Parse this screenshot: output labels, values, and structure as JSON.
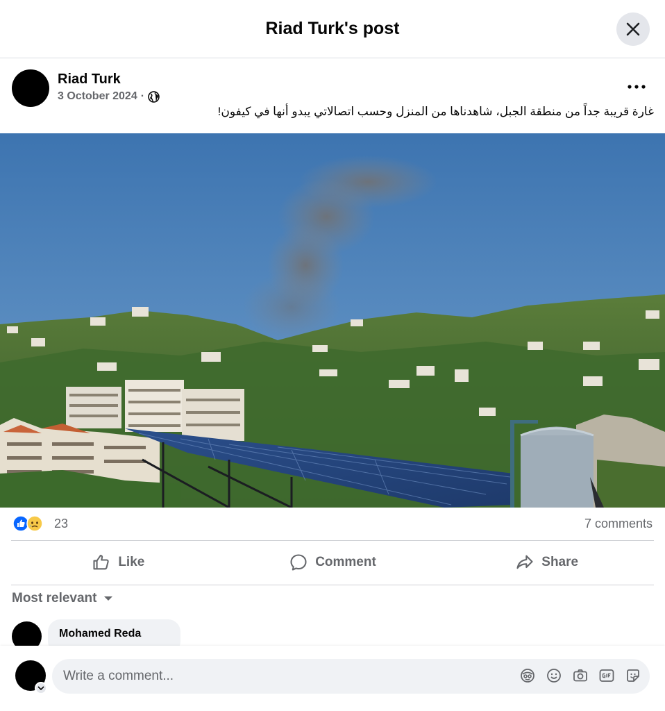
{
  "header": {
    "title": "Riad Turk's post"
  },
  "post": {
    "author": "Riad Turk",
    "date": "3 October 2024",
    "separator": "·",
    "audience_icon": "globe-icon",
    "text": "غارة قريبة جداً من منطقة الجبل، شاهدناها من المنزل وحسب اتصالاتي يبدو أنها في كيفون!"
  },
  "reactions": {
    "count": "23",
    "icons": [
      "like-icon",
      "sad-icon"
    ],
    "comments": "7 comments"
  },
  "actions": {
    "like": "Like",
    "comment": "Comment",
    "share": "Share"
  },
  "sort": {
    "label": "Most relevant"
  },
  "comments": [
    {
      "author": "Mohamed Reda"
    }
  ],
  "composer": {
    "placeholder": "Write a comment...",
    "tools": [
      "avatar-sticker-icon",
      "emoji-icon",
      "camera-icon",
      "gif-icon",
      "sticker-icon"
    ]
  },
  "colors": {
    "like_blue": "#0866ff",
    "muted": "#65676b",
    "bubble": "#f0f2f5"
  }
}
